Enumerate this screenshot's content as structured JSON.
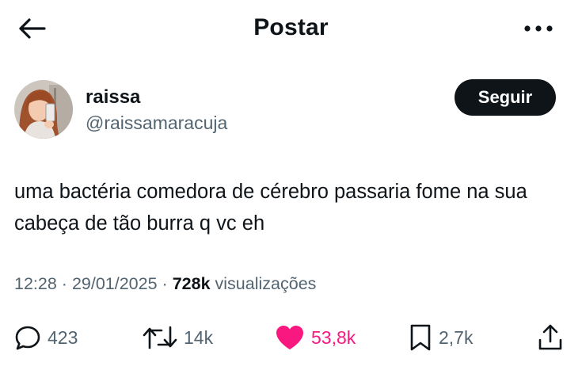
{
  "header": {
    "title": "Postar",
    "back_icon": "arrow-left-icon",
    "more_icon": "more-horizontal-icon"
  },
  "author": {
    "name": "raissa",
    "handle": "@raissamaracuja",
    "avatar_icon": "profile-photo"
  },
  "follow_label": "Seguir",
  "post": {
    "text": "uma bactéria comedora de cérebro passaria fome na sua cabeça de tão burra q vc eh"
  },
  "meta": {
    "time": "12:28",
    "separator": "·",
    "date": "29/01/2025",
    "views_count": "728k",
    "views_label": "visualizações"
  },
  "actions": {
    "replies": "423",
    "reposts": "14k",
    "likes": "53,8k",
    "bookmarks": "2,7k"
  },
  "colors": {
    "text": "#0f1419",
    "secondary": "#536471",
    "like": "#f91880",
    "button_bg": "#0f1419"
  }
}
